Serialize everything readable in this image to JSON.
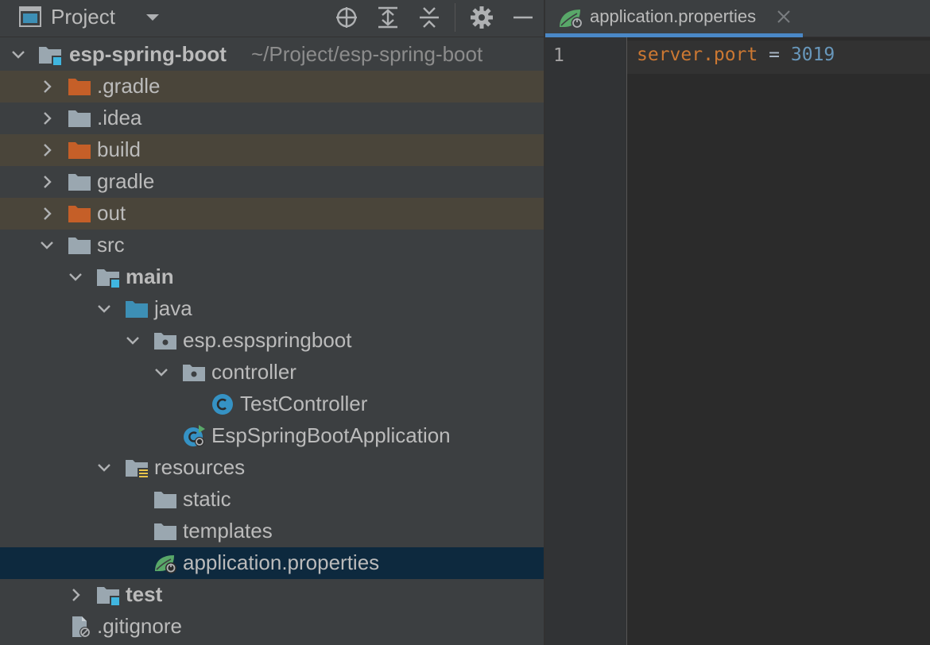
{
  "project_panel": {
    "title": "Project",
    "header_icons": [
      "locate-icon",
      "expand-all-icon",
      "collapse-all-icon",
      "gear-icon",
      "minimize-icon"
    ]
  },
  "tree": {
    "root": {
      "name": "esp-spring-boot",
      "path": "~/Project/esp-spring-boot"
    },
    "items": [
      {
        "label": ".gradle"
      },
      {
        "label": ".idea"
      },
      {
        "label": "build"
      },
      {
        "label": "gradle"
      },
      {
        "label": "out"
      },
      {
        "label": "src"
      },
      {
        "label": "main"
      },
      {
        "label": "java"
      },
      {
        "label": "esp.espspringboot"
      },
      {
        "label": "controller"
      },
      {
        "label": "TestController"
      },
      {
        "label": "EspSpringBootApplication"
      },
      {
        "label": "resources"
      },
      {
        "label": "static"
      },
      {
        "label": "templates"
      },
      {
        "label": "application.properties"
      },
      {
        "label": "test"
      },
      {
        "label": ".gitignore"
      }
    ]
  },
  "editor": {
    "tab_label": "application.properties",
    "line_number": "1",
    "code": {
      "key": "server.port",
      "op": " = ",
      "value": "3019"
    }
  },
  "colors": {
    "panel_bg": "#3c3f41",
    "editor_bg": "#2b2b2b",
    "excluded_bg": "#4a453a",
    "selected_bg": "#0d293e",
    "excluded_folder": "#c55f28",
    "folder": "#9aa7b0",
    "source_folder": "#3d8fb5",
    "key": "#cc7832",
    "value": "#6897bb",
    "accent": "#4a88c7"
  }
}
